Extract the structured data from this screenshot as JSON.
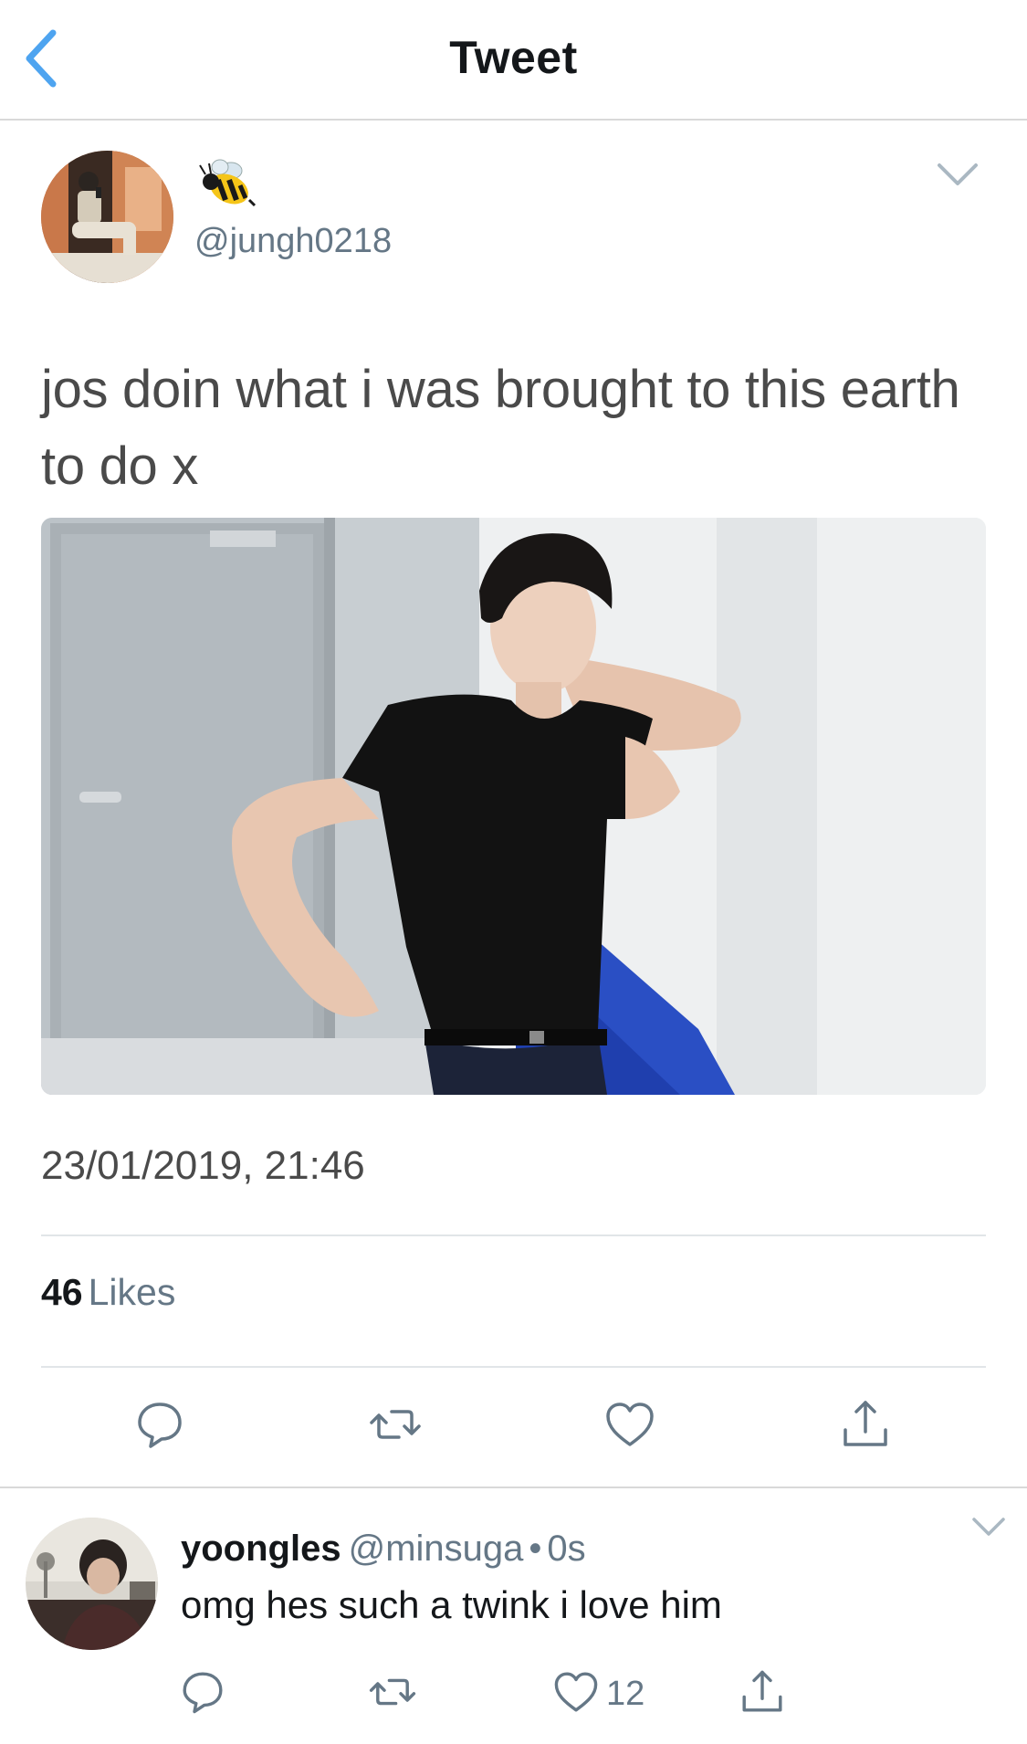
{
  "nav": {
    "title": "Tweet",
    "back_icon": "chevron-left-icon"
  },
  "tweet": {
    "emoji_name": "🐝",
    "handle": "@jungh0218",
    "text": "jos doin what i was brought to this earth to do x",
    "timestamp": "23/01/2019, 21:46",
    "likes_count": "46",
    "likes_label": "Likes"
  },
  "actions": [
    "reply-icon",
    "retweet-icon",
    "like-icon",
    "share-icon"
  ],
  "reply": {
    "name": "yoongles",
    "handle": "@minsuga",
    "dot": "•",
    "time": "0s",
    "text": "omg hes such a twink i love him",
    "like_count": "12"
  },
  "colors": {
    "accent": "#1da1f2",
    "text_primary": "#14171a",
    "text_secondary": "#657786",
    "divider": "#e1e5e8"
  }
}
